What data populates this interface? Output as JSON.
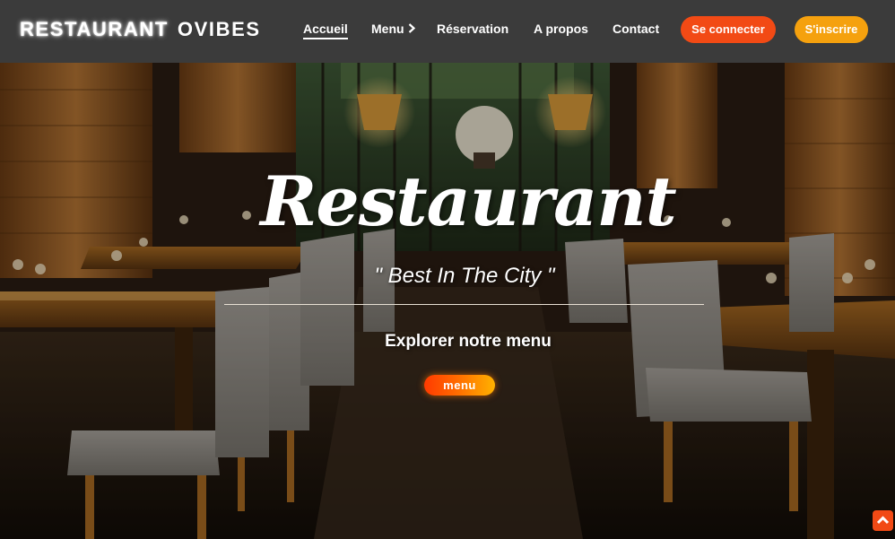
{
  "header": {
    "brand_part1": "RESTAURANT",
    "brand_part2": "OVIBES",
    "nav": {
      "accueil": "Accueil",
      "menu": "Menu",
      "reservation": "Réservation",
      "apropos": "A propos",
      "contact": "Contact"
    },
    "login_label": "Se connecter",
    "signup_label": "S'inscrire"
  },
  "hero": {
    "title": "Restaurant",
    "subtitle": "\" Best In The City \"",
    "explore": "Explorer notre menu",
    "menu_button": "menu"
  },
  "icons": {
    "menu_chevron": "chevron-right-icon",
    "scroll_top": "chevron-up-icon"
  },
  "colors": {
    "header_bg": "#3b3b3b",
    "login_button": "#f24a15",
    "signup_button": "#f5a10e",
    "menu_button_gradient": [
      "#ff3a00",
      "#ffb200"
    ]
  }
}
